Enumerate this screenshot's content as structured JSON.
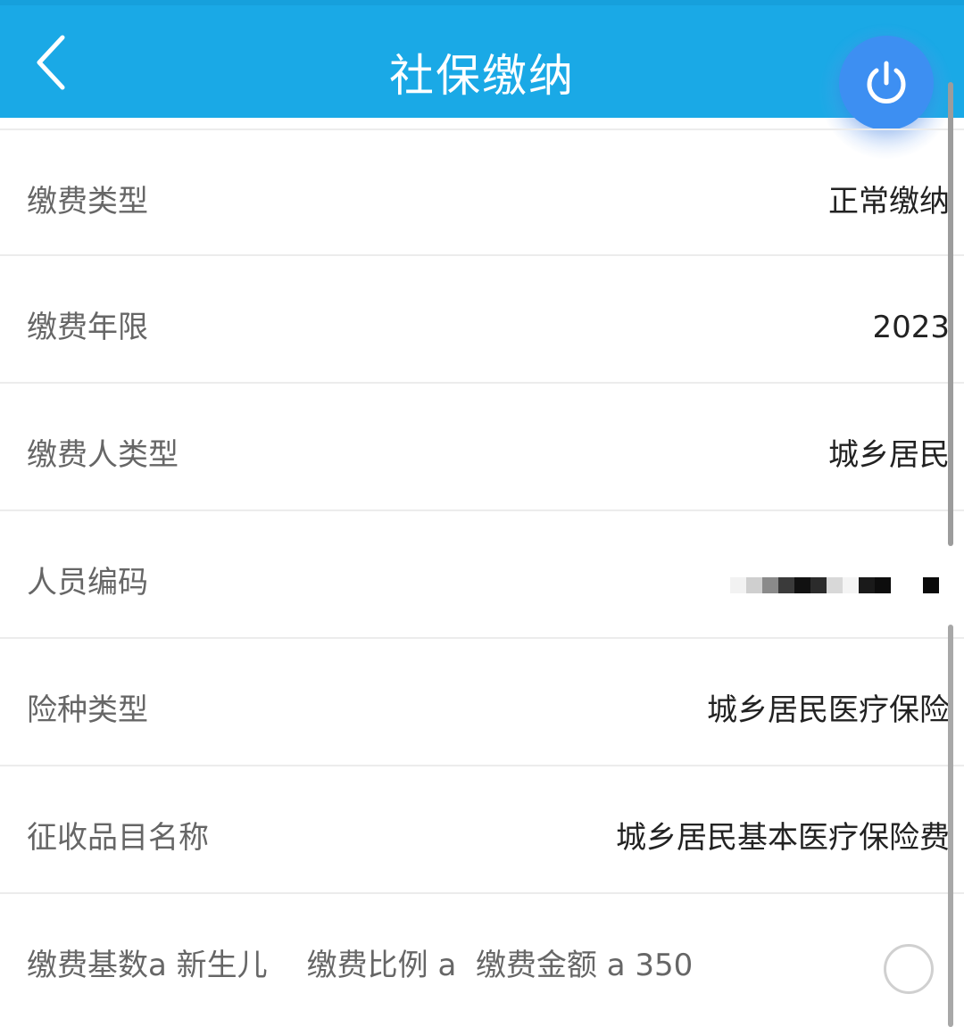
{
  "header": {
    "title": "社保缴纳",
    "back_icon": "chevron-left-icon",
    "power_icon": "power-icon",
    "bg_color": "#1aa9e6",
    "power_color": "#3d8ff2"
  },
  "rows": [
    {
      "label": "缴费类型",
      "value": "正常缴纳"
    },
    {
      "label": "缴费年限",
      "value": "2023"
    },
    {
      "label": "缴费人类型",
      "value": "城乡居民"
    },
    {
      "label": "人员编码",
      "value": ""
    },
    {
      "label": "险种类型",
      "value": "城乡居民医疗保险"
    },
    {
      "label": "征收品目名称",
      "value": "城乡居民基本医疗保险费"
    }
  ],
  "payment_row": {
    "base_label": "缴费基数a 新生儿",
    "ratio_label": "缴费比例 a",
    "amount_label": "缴费金额 a 350",
    "radio_icon": "radio-unchecked-icon"
  }
}
